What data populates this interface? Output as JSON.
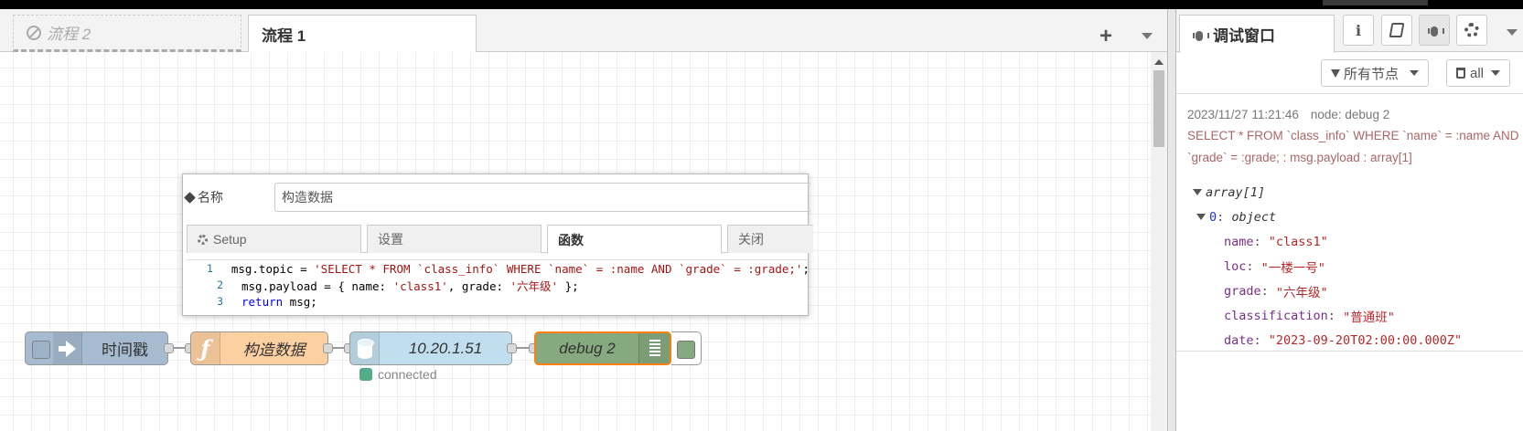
{
  "tabs": [
    {
      "label": "流程 2",
      "disabled": true
    },
    {
      "label": "流程 1",
      "active": true
    }
  ],
  "tab_actions": {
    "add": "+"
  },
  "editor": {
    "name_label": "名称",
    "name_value": "构造数据",
    "tabs": [
      "Setup",
      "设置",
      "函数",
      "关闭"
    ],
    "code": [
      {
        "n": "1",
        "parts": [
          {
            "t": "msg.topic = ",
            "c": ""
          },
          {
            "t": "'SELECT * FROM `class_info` WHERE `name` = :name AND `grade` = :grade;'",
            "c": "tk-str"
          },
          {
            "t": ";",
            "c": ""
          }
        ]
      },
      {
        "n": "2",
        "parts": [
          {
            "t": "msg.payload = { name: ",
            "c": ""
          },
          {
            "t": "'class1'",
            "c": "tk-str"
          },
          {
            "t": ", grade: ",
            "c": ""
          },
          {
            "t": "'六年级'",
            "c": "tk-str"
          },
          {
            "t": " };",
            "c": ""
          }
        ]
      },
      {
        "n": "3",
        "parts": [
          {
            "t": "return",
            "c": "tk-kw"
          },
          {
            "t": " msg;",
            "c": ""
          }
        ]
      }
    ]
  },
  "nodes": {
    "inject": {
      "label": "时间戳",
      "color": "#a6bbcf"
    },
    "function": {
      "label": "构造数据",
      "color": "#fdd0a2"
    },
    "mysql": {
      "label": "10.20.1.51",
      "color": "#c0deed",
      "status": "connected"
    },
    "debug": {
      "label": "debug 2",
      "color": "#87a980"
    }
  },
  "sidebar": {
    "title": "调试窗口",
    "info_btn": "i",
    "filter_label": "所有节点",
    "clear_label": "all",
    "message": {
      "timestamp": "2023/11/27 11:21:46",
      "node": "node: debug 2",
      "topic": "SELECT * FROM `class_info` WHERE `name` = :name AND `grade` = :grade; : msg.payload : array[1]",
      "root_type": "array[1]",
      "item_index": "0",
      "item_type": "object",
      "fields": [
        {
          "key": "name",
          "value": "\"class1\""
        },
        {
          "key": "loc",
          "value": "\"一楼一号\""
        },
        {
          "key": "grade",
          "value": "\"六年级\""
        },
        {
          "key": "classification",
          "value": "\"普通班\""
        },
        {
          "key": "date",
          "value": "\"2023-09-20T02:00:00.000Z\""
        }
      ]
    }
  },
  "colors": {
    "accent_orange": "#ff7f0e",
    "status_connected": "#55aa88"
  }
}
